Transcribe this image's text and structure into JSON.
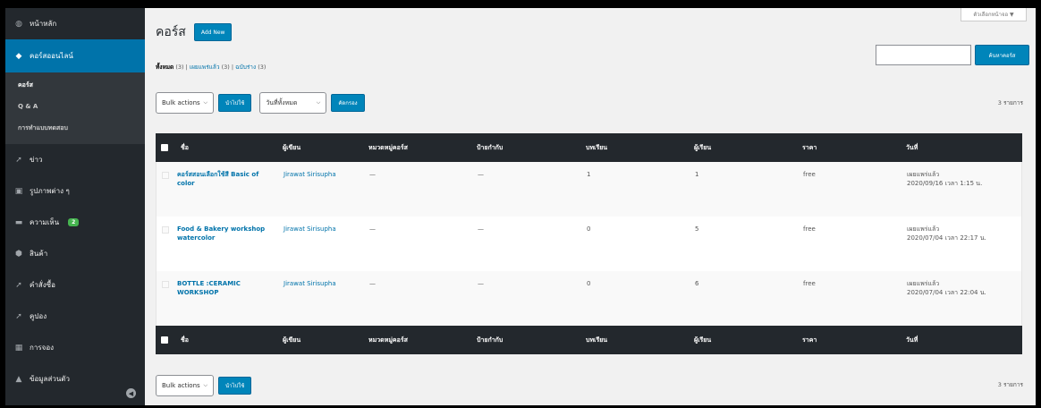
{
  "sidebar": {
    "items": [
      {
        "label": "หน้าหลัก",
        "icon": "dashboard-icon",
        "glyph": "◍"
      },
      {
        "label": "คอร์สออนไลน์",
        "icon": "graduation-cap-icon",
        "glyph": "◆"
      },
      {
        "label": "ข่าว",
        "icon": "pin-icon",
        "glyph": "➚"
      },
      {
        "label": "รูปภาพต่าง ๆ",
        "icon": "media-icon",
        "glyph": "▣"
      },
      {
        "label": "ความเห็น",
        "icon": "comment-icon",
        "glyph": "▬",
        "badge": "2"
      },
      {
        "label": "สินค้า",
        "icon": "product-icon",
        "glyph": "⬢"
      },
      {
        "label": "คำสั่งซื้อ",
        "icon": "pin-icon",
        "glyph": "➚"
      },
      {
        "label": "คูปอง",
        "icon": "pin-icon",
        "glyph": "➚"
      },
      {
        "label": "การจอง",
        "icon": "calendar-icon",
        "glyph": "▦"
      },
      {
        "label": "ข้อมูลส่วนตัว",
        "icon": "user-icon",
        "glyph": "▲"
      }
    ],
    "submenu": [
      "คอร์ส",
      "Q & A",
      "การทำแบบทดสอบ"
    ],
    "collapse_glyph": "◀"
  },
  "header": {
    "title": "คอร์ส",
    "add_new": "Add New",
    "screen_options": "ตัวเลือกหน้าจอ ▼",
    "search_button": "ค้นหาคอร์ส"
  },
  "filters": {
    "all": "ทั้งหมด",
    "all_count": "(3)",
    "published": "เผยแพร่แล้ว",
    "published_count": "(3)",
    "draft": "ฉบับร่าง",
    "draft_count": "(3)"
  },
  "tablenav": {
    "bulk_actions": "Bulk actions",
    "apply": "นำไปใช้",
    "date_filter": "วันที่ทั้งหมด",
    "filter_button": "คัดกรอง",
    "item_count": "3 รายการ"
  },
  "table": {
    "headers": [
      "ชื่อ",
      "ผู้เขียน",
      "หมวดหมู่คอร์ส",
      "ป้ายกำกับ",
      "บทเรียน",
      "ผู้เรียน",
      "ราคา",
      "วันที่"
    ],
    "rows": [
      {
        "title": "คอร์สสอนเลือกใช้สี Basic of color",
        "author": "Jirawat Sirisupha",
        "category": "—",
        "tags": "—",
        "lessons": "1",
        "students": "1",
        "price": "free",
        "status": "เผยแพร่แล้ว",
        "date": "2020/09/16 เวลา 1:15 น."
      },
      {
        "title": "Food & Bakery workshop watercolor",
        "author": "Jirawat Sirisupha",
        "category": "—",
        "tags": "—",
        "lessons": "0",
        "students": "5",
        "price": "free",
        "status": "เผยแพร่แล้ว",
        "date": "2020/07/04 เวลา 22:17 น."
      },
      {
        "title": "BOTTLE :CERAMIC WORKSHOP",
        "author": "Jirawat Sirisupha",
        "category": "—",
        "tags": "—",
        "lessons": "0",
        "students": "6",
        "price": "free",
        "status": "เผยแพร่แล้ว",
        "date": "2020/07/04 เวลา 22:04 น."
      }
    ]
  },
  "colors": {
    "sidebar": "#23282d",
    "accent": "#0073aa",
    "button": "#0085ba",
    "badge": "#46b450"
  }
}
